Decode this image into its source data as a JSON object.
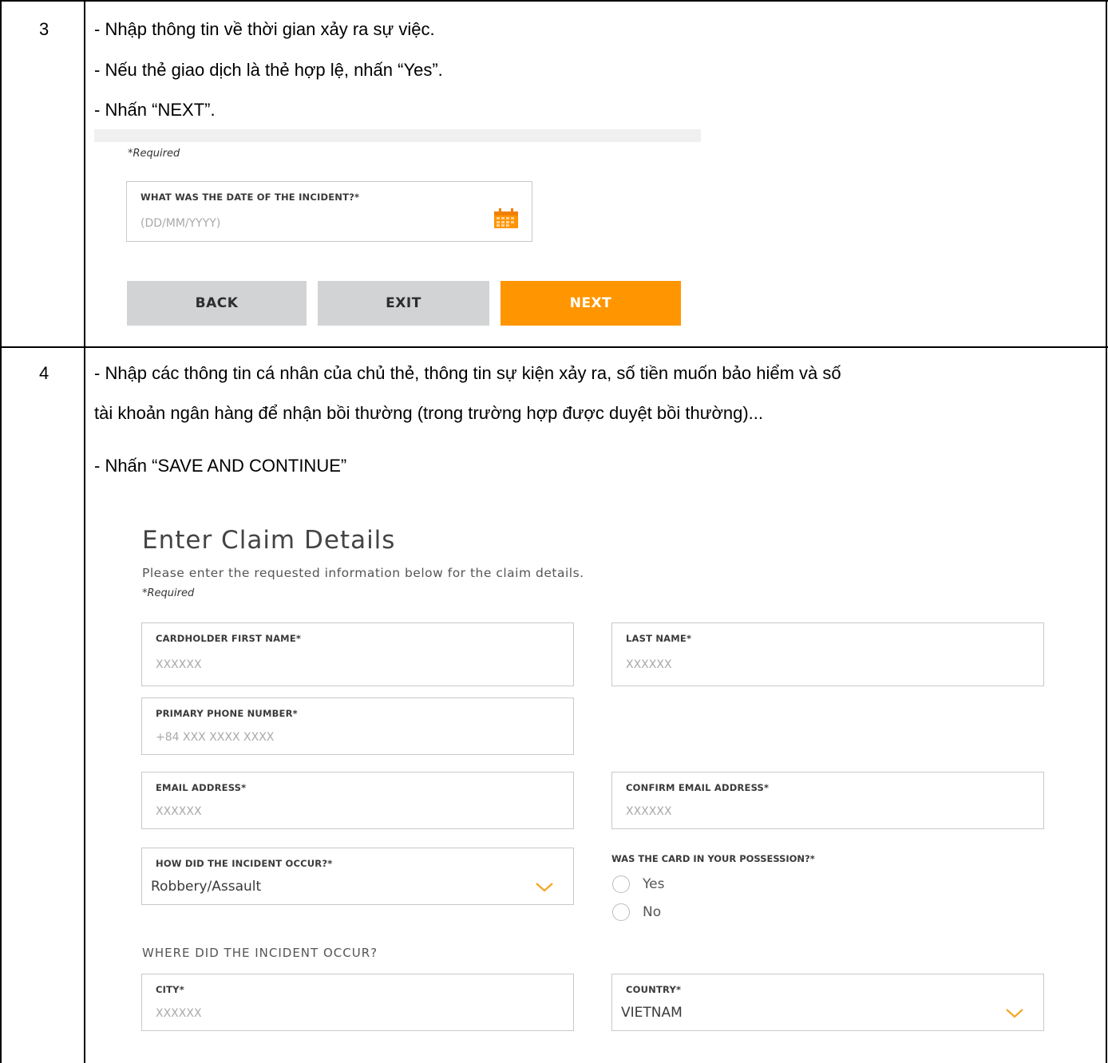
{
  "step3": {
    "number": "3",
    "lines": [
      "- Nhập thông tin về thời gian xảy ra sự việc.",
      "- Nếu thẻ giao dịch là thẻ hợp lệ, nhấn “Yes”.",
      "- Nhấn “NEXT”."
    ],
    "screenshot": {
      "required_note": "*Required",
      "date_field": {
        "label": "WHAT WAS THE DATE OF THE INCIDENT?*",
        "placeholder": "(DD/MM/YYYY)",
        "icon": "calendar-icon"
      },
      "buttons": {
        "back": "BACK",
        "exit": "EXIT",
        "next": "NEXT"
      },
      "colors": {
        "accent": "#ff9500",
        "grey_button": "#d1d3d4"
      }
    }
  },
  "step4": {
    "number": "4",
    "lines": [
      "- Nhập các thông tin cá nhân của chủ thẻ, thông tin sự kiện xảy ra, số tiền muốn bảo hiểm và số",
      "tài khoản ngân hàng để nhận bồi thường (trong trường hợp được duyệt bồi thường)...",
      "- Nhấn “SAVE AND CONTINUE”"
    ],
    "screenshot": {
      "title": "Enter Claim Details",
      "subtitle": "Please enter the requested information below for the claim details.",
      "required_note": "*Required",
      "first_name": {
        "label": "CARDHOLDER FIRST NAME*",
        "value": "XXXXXX"
      },
      "last_name": {
        "label": "LAST NAME*",
        "value": "XXXXXX"
      },
      "phone": {
        "label": "PRIMARY PHONE NUMBER*",
        "value": "+84 XXX XXXX XXXX"
      },
      "email": {
        "label": "EMAIL ADDRESS*",
        "value": "XXXXXX"
      },
      "confirm_email": {
        "label": "CONFIRM EMAIL ADDRESS*",
        "value": "XXXXXX"
      },
      "incident_how": {
        "label": "HOW DID THE INCIDENT OCCUR?*",
        "selected": "Robbery/Assault"
      },
      "possession": {
        "label": "WAS THE CARD IN YOUR POSSESSION?*",
        "options": [
          "Yes",
          "No"
        ]
      },
      "where_heading": "WHERE DID THE INCIDENT OCCUR?",
      "city": {
        "label": "CITY*",
        "value": "XXXXXX"
      },
      "country": {
        "label": "COUNTRY*",
        "selected": "VIETNAM"
      }
    }
  }
}
